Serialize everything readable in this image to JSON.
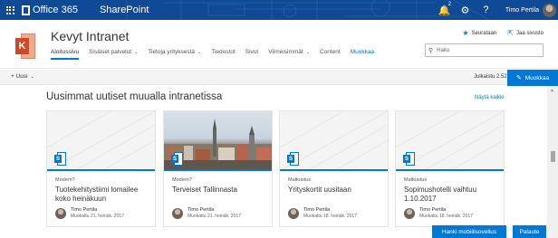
{
  "suite": {
    "brand": "Office 365",
    "app": "SharePoint",
    "notifications_count": "2",
    "user_name": "Timo Pertila",
    "icons": [
      "waffle-icon",
      "bell-icon",
      "gear-icon",
      "help-icon"
    ]
  },
  "site": {
    "logo_letter": "K",
    "title": "Kevyt Intranet",
    "nav": [
      {
        "label": "Aloitussivu"
      },
      {
        "label": "Sisäiset palvelut"
      },
      {
        "label": "Tietoja yrityksestä"
      },
      {
        "label": "Tiedostot"
      },
      {
        "label": "Sivut"
      },
      {
        "label": "Viimeisimmät"
      },
      {
        "label": "Content"
      },
      {
        "label": "Muokkaa"
      }
    ],
    "follow_label": "Seurataan",
    "share_label": "Jaa sivusto",
    "search_placeholder": "Haku"
  },
  "command_bar": {
    "new_label": "Uusi",
    "published": "Julkaistu 2.52",
    "edit_label": "Muokkaa"
  },
  "news": {
    "title": "Uusimmat uutiset muualla intranetissa",
    "see_all": "Näytä kaikki",
    "items": [
      {
        "category": "Modern?",
        "title": "Tuotekehitystiimi lomailee koko heinäkuun",
        "author": "Timo Pertila",
        "modified": "Muokattu 21. heinäk. 2017"
      },
      {
        "category": "Modern?",
        "title": "Terveiset Tallinnasta",
        "author": "Timo Pertila",
        "modified": "Muokattu 21. heinäk. 2017"
      },
      {
        "category": "Matkustus",
        "title": "Yrityskortit uusitaan",
        "author": "Timo Pertila",
        "modified": "Muokattu 18. heinäk. 2017"
      },
      {
        "category": "Matkustus",
        "title": "Sopimushotelli vaihtuu 1.10.2017",
        "author": "Timo Pertila",
        "modified": "Muokattu 18. heinäk. 2017"
      }
    ]
  },
  "footer": {
    "mobile_label": "Hanki mobiilisovellus",
    "feedback_label": "Palaute"
  },
  "colors": {
    "suite_bar": "#0f4a96",
    "accent": "#0078d4",
    "site_logo": "#d24726"
  }
}
